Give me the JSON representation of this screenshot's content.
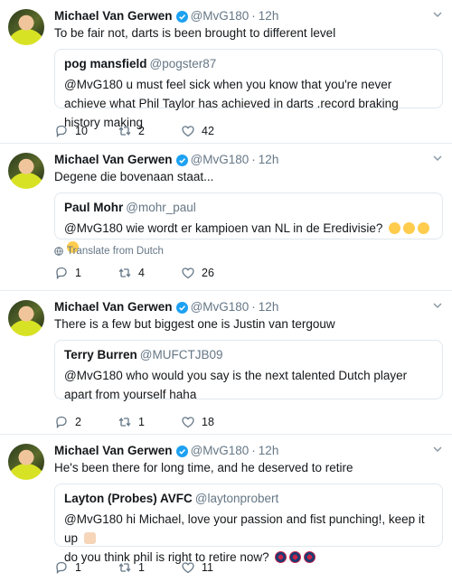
{
  "tweets": [
    {
      "name": "Michael Van Gerwen",
      "handle": "@MvG180",
      "time": "12h",
      "text": "To be fair not, darts is been brought to different level",
      "quote": {
        "name": "pog mansfield",
        "handle": "@pogster87",
        "text": "@MvG180 u must feel sick when you know that you're never achieve what Phil Taylor has achieved in darts .record braking history making"
      },
      "translate": "",
      "replies": "10",
      "retweets": "2",
      "likes": "42"
    },
    {
      "name": "Michael Van Gerwen",
      "handle": "@MvG180",
      "time": "12h",
      "text": "Degene die bovenaan staat...",
      "quote": {
        "name": "Paul Mohr",
        "handle": "@mohr_paul",
        "text": "@MvG180 wie wordt er kampioen van NL in de Eredivisie?"
      },
      "translate": "Translate from Dutch",
      "replies": "1",
      "retweets": "4",
      "likes": "26"
    },
    {
      "name": "Michael Van Gerwen",
      "handle": "@MvG180",
      "time": "12h",
      "text": "There is a few but biggest one is Justin van tergouw",
      "quote": {
        "name": "Terry Burren",
        "handle": "@MUFCTJB09",
        "text": "@MvG180 who would you say is the next talented Dutch player apart from yourself haha"
      },
      "translate": "",
      "replies": "2",
      "retweets": "1",
      "likes": "18"
    },
    {
      "name": "Michael Van Gerwen",
      "handle": "@MvG180",
      "time": "12h",
      "text": "He's been there for long time, and he deserved to retire",
      "quote": {
        "name": "Layton (Probes) AVFC",
        "handle": "@laytonprobert",
        "text": "@MvG180 hi Michael, love your passion and fist punching!, keep it up",
        "text2": "do you think phil is right to retire now?"
      },
      "translate": "",
      "replies": "1",
      "retweets": "1",
      "likes": "11"
    }
  ],
  "separator": "·",
  "colors": {
    "accent": "#1da1f2",
    "muted": "#657786",
    "border": "#e6ecf0"
  },
  "icons": [
    "verified-badge-icon",
    "chevron-down-icon",
    "globe-icon",
    "reply-icon",
    "retweet-icon",
    "like-icon"
  ]
}
